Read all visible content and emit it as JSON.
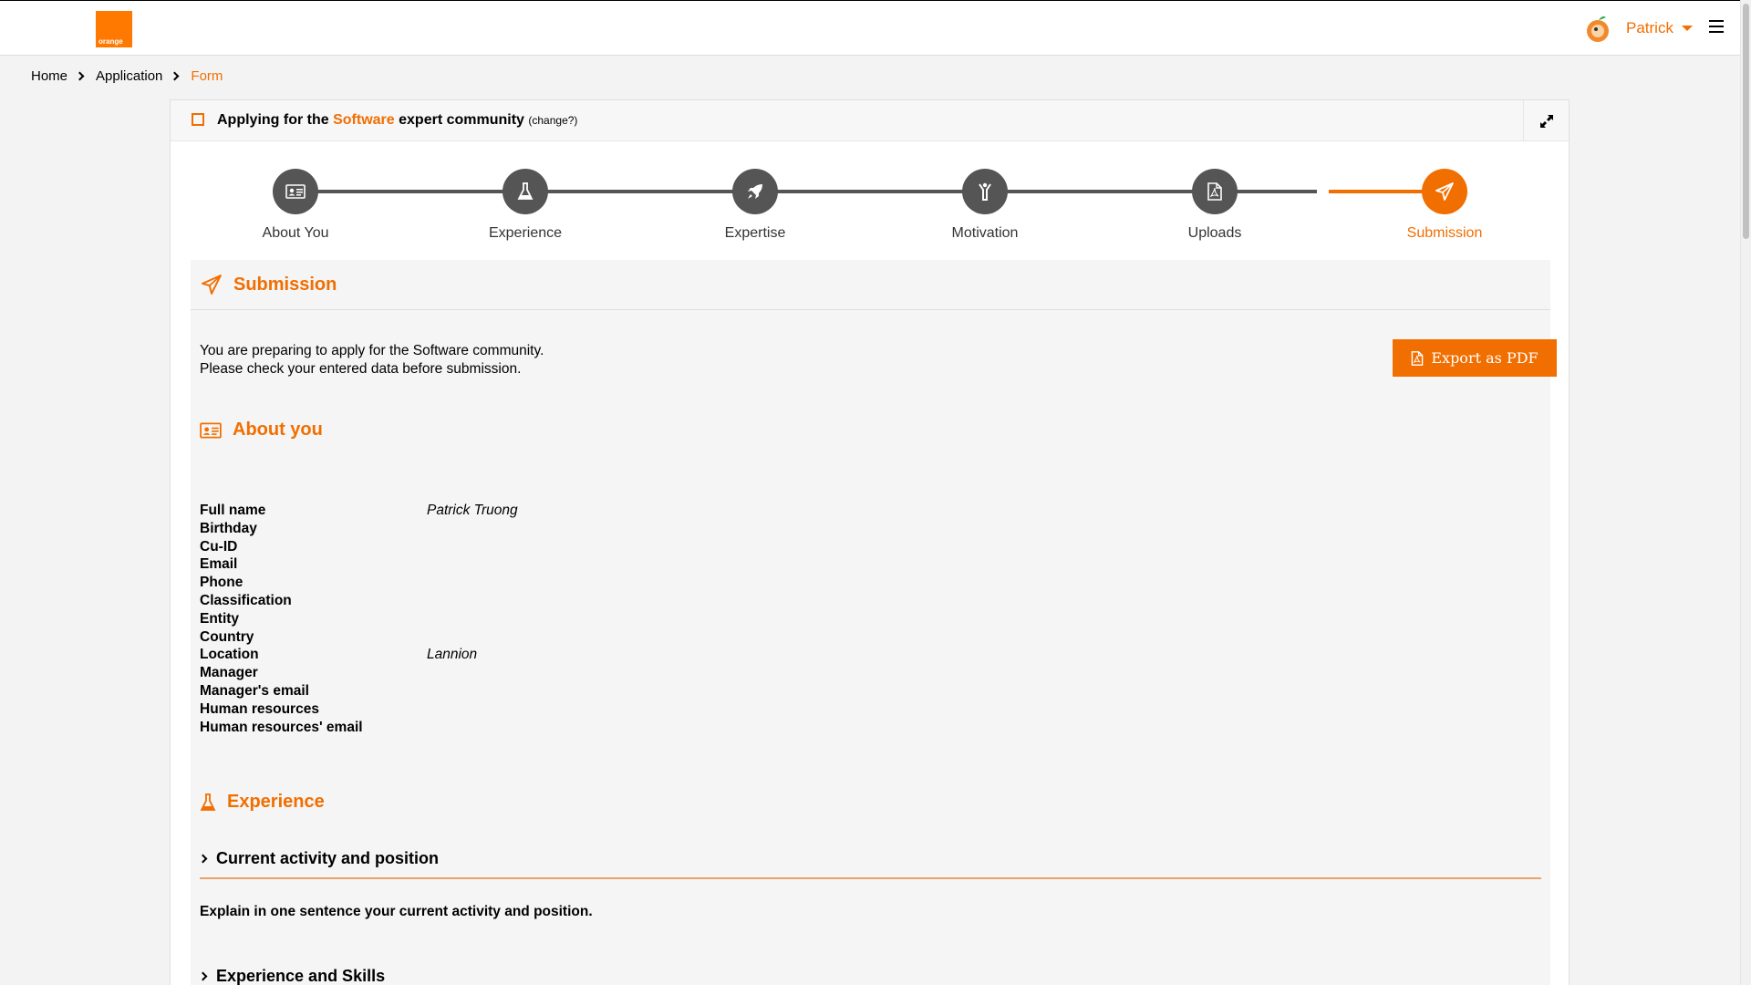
{
  "header": {
    "logo_text": "orange",
    "user_name": "Patrick"
  },
  "breadcrumb": [
    "Home",
    "Application",
    "Form"
  ],
  "card": {
    "title_prefix": "Applying for the ",
    "community": "Software",
    "title_suffix": " expert community ",
    "change_label": "(change?)"
  },
  "steps": [
    {
      "label": "About You",
      "icon": "id-card-icon",
      "active": false
    },
    {
      "label": "Experience",
      "icon": "flask-icon",
      "active": false
    },
    {
      "label": "Expertise",
      "icon": "rocket-icon",
      "active": false
    },
    {
      "label": "Motivation",
      "icon": "person-raised-arms-icon",
      "active": false
    },
    {
      "label": "Uploads",
      "icon": "pdf-file-icon",
      "active": false
    },
    {
      "label": "Submission",
      "icon": "paper-plane-icon",
      "active": true
    }
  ],
  "submission": {
    "title": "Submission",
    "intro_line1": "You are preparing to apply for the Software community.",
    "intro_line2": "Please check your entered data before submission.",
    "export_label": "Export as PDF"
  },
  "about": {
    "title": "About you",
    "fields": [
      {
        "label": "Full name",
        "value": "Patrick Truong"
      },
      {
        "label": "Birthday",
        "value": ""
      },
      {
        "label": "Cu-ID",
        "value": ""
      },
      {
        "label": "Email",
        "value": ""
      },
      {
        "label": "Phone",
        "value": ""
      },
      {
        "label": "Classification",
        "value": ""
      },
      {
        "label": "Entity",
        "value": ""
      },
      {
        "label": "Country",
        "value": ""
      },
      {
        "label": "Location",
        "value": "Lannion"
      },
      {
        "label": "Manager",
        "value": ""
      },
      {
        "label": "Manager's email",
        "value": ""
      },
      {
        "label": "Human resources",
        "value": ""
      },
      {
        "label": "Human resources' email",
        "value": ""
      }
    ]
  },
  "experience": {
    "title": "Experience",
    "sections": [
      {
        "title": "Current activity and position",
        "question": "Explain in one sentence your current activity and position."
      },
      {
        "title": "Experience and Skills"
      }
    ]
  },
  "colors": {
    "accent": "#f16e00",
    "step_inactive": "#555555"
  }
}
